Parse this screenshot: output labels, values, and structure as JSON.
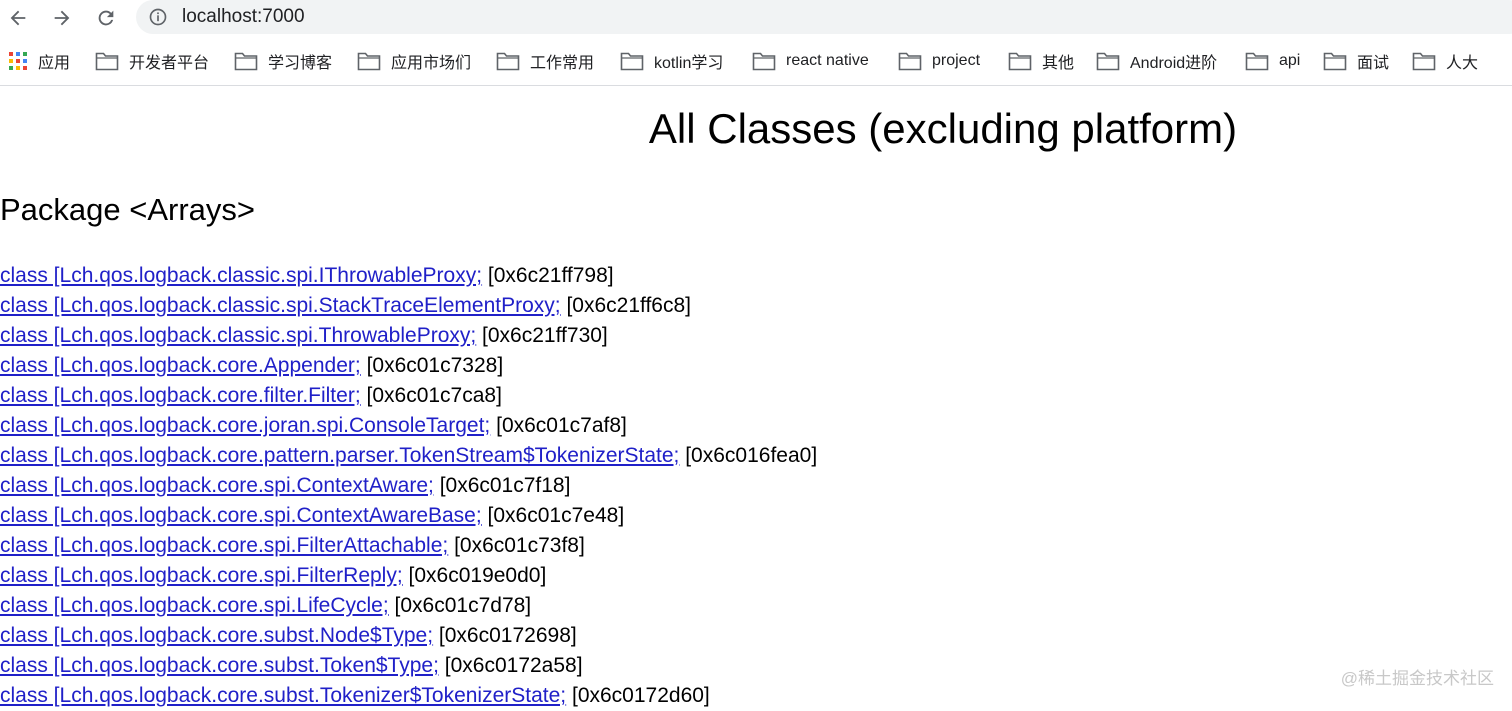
{
  "browser": {
    "url": "localhost:7000",
    "icons": {
      "back": "arrow-left-icon",
      "forward": "arrow-right-icon",
      "reload": "reload-icon",
      "info": "info-icon",
      "apps": "apps-grid-icon",
      "folder": "folder-icon"
    }
  },
  "bookmarks": [
    "应用",
    "开发者平台",
    "学习博客",
    "应用市场们",
    "工作常用",
    "kotlin学习",
    "react native",
    "project",
    "其他",
    "Android进阶",
    "api",
    "面试",
    "人大"
  ],
  "page": {
    "title": "All Classes (excluding platform)",
    "package_heading": "Package <Arrays>",
    "classes": [
      {
        "name": "class [Lch.qos.logback.classic.spi.IThrowableProxy;",
        "addr": "[0x6c21ff798]"
      },
      {
        "name": "class [Lch.qos.logback.classic.spi.StackTraceElementProxy;",
        "addr": "[0x6c21ff6c8]"
      },
      {
        "name": "class [Lch.qos.logback.classic.spi.ThrowableProxy;",
        "addr": "[0x6c21ff730]"
      },
      {
        "name": "class [Lch.qos.logback.core.Appender;",
        "addr": "[0x6c01c7328]"
      },
      {
        "name": "class [Lch.qos.logback.core.filter.Filter;",
        "addr": "[0x6c01c7ca8]"
      },
      {
        "name": "class [Lch.qos.logback.core.joran.spi.ConsoleTarget;",
        "addr": "[0x6c01c7af8]"
      },
      {
        "name": "class [Lch.qos.logback.core.pattern.parser.TokenStream$TokenizerState;",
        "addr": "[0x6c016fea0]"
      },
      {
        "name": "class [Lch.qos.logback.core.spi.ContextAware;",
        "addr": "[0x6c01c7f18]"
      },
      {
        "name": "class [Lch.qos.logback.core.spi.ContextAwareBase;",
        "addr": "[0x6c01c7e48]"
      },
      {
        "name": "class [Lch.qos.logback.core.spi.FilterAttachable;",
        "addr": "[0x6c01c73f8]"
      },
      {
        "name": "class [Lch.qos.logback.core.spi.FilterReply;",
        "addr": "[0x6c019e0d0]"
      },
      {
        "name": "class [Lch.qos.logback.core.spi.LifeCycle;",
        "addr": "[0x6c01c7d78]"
      },
      {
        "name": "class [Lch.qos.logback.core.subst.Node$Type;",
        "addr": "[0x6c0172698]"
      },
      {
        "name": "class [Lch.qos.logback.core.subst.Token$Type;",
        "addr": "[0x6c0172a58]"
      },
      {
        "name": "class [Lch.qos.logback.core.subst.Tokenizer$TokenizerState;",
        "addr": "[0x6c0172d60]"
      }
    ]
  },
  "watermark": "@稀土掘金技术社区",
  "colors": {
    "link": "#2020c8",
    "omnibox_bg": "#f1f3f4"
  }
}
